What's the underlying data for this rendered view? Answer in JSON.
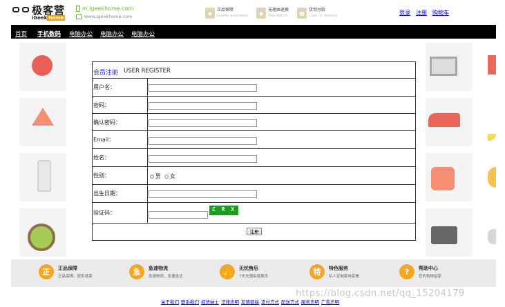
{
  "header": {
    "brand": "极客营",
    "brand_sub_prefix": "iGeek",
    "brand_sub_suffix": "home",
    "site_mobile": "m.igeekhome.com",
    "site_pc": "www.igeekhome.com",
    "badges": [
      {
        "icon": "shield-icon",
        "title": "正品保障",
        "sub": "Quality assurance"
      },
      {
        "icon": "return-icon",
        "title": "无理由退换",
        "sub": "Free Return"
      },
      {
        "icon": "cash-icon",
        "title": "货到付款",
        "sub": "Cash on delivery"
      }
    ],
    "links": [
      "登录",
      "注册",
      "购物车"
    ]
  },
  "nav": {
    "items": [
      "首页",
      "手机数码",
      "电脑办公",
      "电脑办公",
      "电脑办公"
    ]
  },
  "register": {
    "title_cn": "会员注册",
    "title_en": "USER REGISTER",
    "fields": [
      {
        "label": "用户名：",
        "value": ""
      },
      {
        "label": "密码：",
        "value": ""
      },
      {
        "label": "确认密码：",
        "value": ""
      },
      {
        "label": "Email：",
        "value": ""
      },
      {
        "label": "姓名：",
        "value": ""
      }
    ],
    "gender_label": "性别：",
    "gender_options": [
      "男",
      "女"
    ],
    "birthday_label": "出生日期：",
    "birthday_value": "",
    "captcha_label": "验证码：",
    "captcha_value": "",
    "captcha_text": "C R X",
    "submit_label": "注册"
  },
  "services": [
    {
      "icon": "quality-icon",
      "glyph": "正",
      "title": "正品保障",
      "desc": "正品保障，提供发票"
    },
    {
      "icon": "delivery-icon",
      "glyph": "急",
      "title": "急速物流",
      "desc": "急速物流，急速送达"
    },
    {
      "icon": "thumbs-up-icon",
      "glyph": "👍",
      "title": "无忧售后",
      "desc": "7天无理由退换货"
    },
    {
      "icon": "special-icon",
      "glyph": "特",
      "title": "特色服务",
      "desc": "私人定制家电套餐"
    },
    {
      "icon": "help-icon",
      "glyph": "?",
      "title": "帮助中心",
      "desc": "您的购物指南"
    }
  ],
  "footer_links": [
    "关于我们",
    "联系我们",
    "招贤纳士",
    "法律声明",
    "友情链接",
    "支付方式",
    "配送方式",
    "服务声明",
    "广告声明"
  ],
  "watermark": "https://blog.csdn.net/qq_15204179",
  "colors": {
    "accent": "#6bb22c",
    "service": "#f5a623",
    "nav_bg": "#000000",
    "captcha_bg": "#1e9d1e"
  }
}
